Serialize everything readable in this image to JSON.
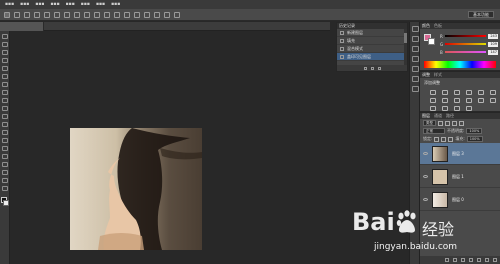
{
  "workspace": {
    "label": "基本功能"
  },
  "history": {
    "title": "历史记录",
    "items": [
      {
        "label": "新建图层"
      },
      {
        "label": "填充"
      },
      {
        "label": "混合模式"
      },
      {
        "label": "盖印可见图层"
      }
    ]
  },
  "color": {
    "title": "颜色",
    "subtitle": "色板",
    "fg": "#d86a94",
    "r": "243",
    "g": "109",
    "b": "147"
  },
  "adjustments": {
    "title": "调整",
    "subtitle": "样式",
    "add_label": "添加调整"
  },
  "layers": {
    "tab_layers": "图层",
    "tab_channels": "通道",
    "tab_paths": "路径",
    "kind": "类型",
    "blend": "正常",
    "opacity_label": "不透明度:",
    "opacity_value": "100%",
    "lock_label": "锁定:",
    "fill_label": "填充:",
    "fill_value": "100%",
    "items": [
      {
        "name": "图层 3"
      },
      {
        "name": "图层 1"
      },
      {
        "name": "图层 0"
      }
    ]
  },
  "watermark": {
    "brand": "Bai",
    "text": "经验",
    "url": "jingyan.baidu.com"
  }
}
